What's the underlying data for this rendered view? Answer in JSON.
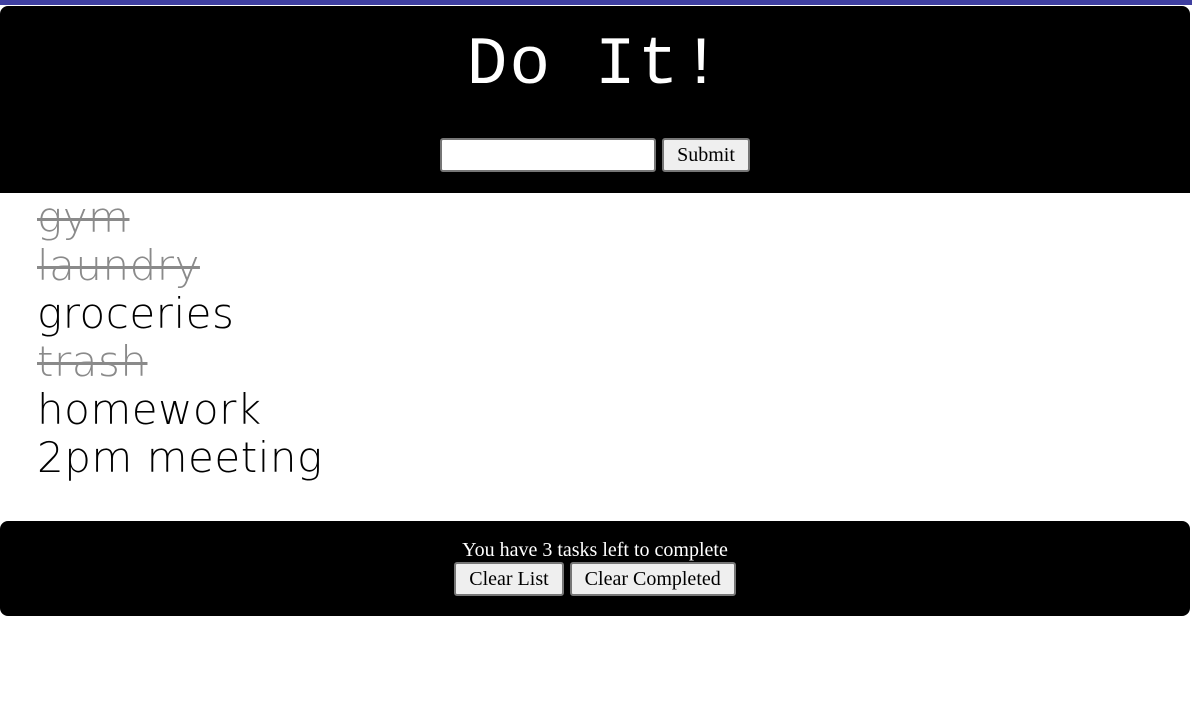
{
  "app": {
    "title": "Do It!"
  },
  "form": {
    "input_value": "",
    "input_placeholder": "",
    "submit_label": "Submit"
  },
  "tasks": [
    {
      "text": "gym",
      "completed": true
    },
    {
      "text": "laundry",
      "completed": true
    },
    {
      "text": "groceries",
      "completed": false
    },
    {
      "text": "trash",
      "completed": true
    },
    {
      "text": "homework",
      "completed": false
    },
    {
      "text": "2pm meeting",
      "completed": false
    }
  ],
  "footer": {
    "remaining_text": "You have 3 tasks left to complete",
    "clear_list_label": "Clear List",
    "clear_completed_label": "Clear Completed"
  },
  "colors": {
    "accent_stripe": "#3f3fa0",
    "header_bg": "#000000",
    "completed_text": "#8a8a8a"
  }
}
